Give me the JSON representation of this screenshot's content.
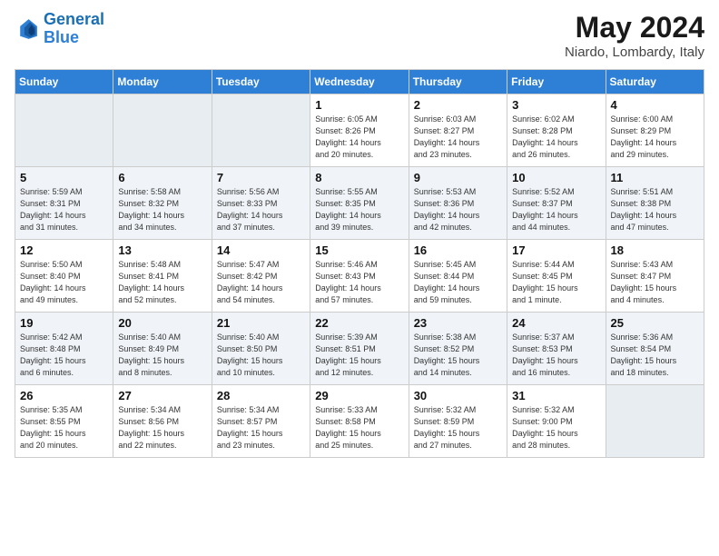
{
  "logo": {
    "line1": "General",
    "line2": "Blue"
  },
  "title": "May 2024",
  "subtitle": "Niardo, Lombardy, Italy",
  "days_header": [
    "Sunday",
    "Monday",
    "Tuesday",
    "Wednesday",
    "Thursday",
    "Friday",
    "Saturday"
  ],
  "weeks": [
    [
      {
        "day": "",
        "info": ""
      },
      {
        "day": "",
        "info": ""
      },
      {
        "day": "",
        "info": ""
      },
      {
        "day": "1",
        "info": "Sunrise: 6:05 AM\nSunset: 8:26 PM\nDaylight: 14 hours\nand 20 minutes."
      },
      {
        "day": "2",
        "info": "Sunrise: 6:03 AM\nSunset: 8:27 PM\nDaylight: 14 hours\nand 23 minutes."
      },
      {
        "day": "3",
        "info": "Sunrise: 6:02 AM\nSunset: 8:28 PM\nDaylight: 14 hours\nand 26 minutes."
      },
      {
        "day": "4",
        "info": "Sunrise: 6:00 AM\nSunset: 8:29 PM\nDaylight: 14 hours\nand 29 minutes."
      }
    ],
    [
      {
        "day": "5",
        "info": "Sunrise: 5:59 AM\nSunset: 8:31 PM\nDaylight: 14 hours\nand 31 minutes."
      },
      {
        "day": "6",
        "info": "Sunrise: 5:58 AM\nSunset: 8:32 PM\nDaylight: 14 hours\nand 34 minutes."
      },
      {
        "day": "7",
        "info": "Sunrise: 5:56 AM\nSunset: 8:33 PM\nDaylight: 14 hours\nand 37 minutes."
      },
      {
        "day": "8",
        "info": "Sunrise: 5:55 AM\nSunset: 8:35 PM\nDaylight: 14 hours\nand 39 minutes."
      },
      {
        "day": "9",
        "info": "Sunrise: 5:53 AM\nSunset: 8:36 PM\nDaylight: 14 hours\nand 42 minutes."
      },
      {
        "day": "10",
        "info": "Sunrise: 5:52 AM\nSunset: 8:37 PM\nDaylight: 14 hours\nand 44 minutes."
      },
      {
        "day": "11",
        "info": "Sunrise: 5:51 AM\nSunset: 8:38 PM\nDaylight: 14 hours\nand 47 minutes."
      }
    ],
    [
      {
        "day": "12",
        "info": "Sunrise: 5:50 AM\nSunset: 8:40 PM\nDaylight: 14 hours\nand 49 minutes."
      },
      {
        "day": "13",
        "info": "Sunrise: 5:48 AM\nSunset: 8:41 PM\nDaylight: 14 hours\nand 52 minutes."
      },
      {
        "day": "14",
        "info": "Sunrise: 5:47 AM\nSunset: 8:42 PM\nDaylight: 14 hours\nand 54 minutes."
      },
      {
        "day": "15",
        "info": "Sunrise: 5:46 AM\nSunset: 8:43 PM\nDaylight: 14 hours\nand 57 minutes."
      },
      {
        "day": "16",
        "info": "Sunrise: 5:45 AM\nSunset: 8:44 PM\nDaylight: 14 hours\nand 59 minutes."
      },
      {
        "day": "17",
        "info": "Sunrise: 5:44 AM\nSunset: 8:45 PM\nDaylight: 15 hours\nand 1 minute."
      },
      {
        "day": "18",
        "info": "Sunrise: 5:43 AM\nSunset: 8:47 PM\nDaylight: 15 hours\nand 4 minutes."
      }
    ],
    [
      {
        "day": "19",
        "info": "Sunrise: 5:42 AM\nSunset: 8:48 PM\nDaylight: 15 hours\nand 6 minutes."
      },
      {
        "day": "20",
        "info": "Sunrise: 5:40 AM\nSunset: 8:49 PM\nDaylight: 15 hours\nand 8 minutes."
      },
      {
        "day": "21",
        "info": "Sunrise: 5:40 AM\nSunset: 8:50 PM\nDaylight: 15 hours\nand 10 minutes."
      },
      {
        "day": "22",
        "info": "Sunrise: 5:39 AM\nSunset: 8:51 PM\nDaylight: 15 hours\nand 12 minutes."
      },
      {
        "day": "23",
        "info": "Sunrise: 5:38 AM\nSunset: 8:52 PM\nDaylight: 15 hours\nand 14 minutes."
      },
      {
        "day": "24",
        "info": "Sunrise: 5:37 AM\nSunset: 8:53 PM\nDaylight: 15 hours\nand 16 minutes."
      },
      {
        "day": "25",
        "info": "Sunrise: 5:36 AM\nSunset: 8:54 PM\nDaylight: 15 hours\nand 18 minutes."
      }
    ],
    [
      {
        "day": "26",
        "info": "Sunrise: 5:35 AM\nSunset: 8:55 PM\nDaylight: 15 hours\nand 20 minutes."
      },
      {
        "day": "27",
        "info": "Sunrise: 5:34 AM\nSunset: 8:56 PM\nDaylight: 15 hours\nand 22 minutes."
      },
      {
        "day": "28",
        "info": "Sunrise: 5:34 AM\nSunset: 8:57 PM\nDaylight: 15 hours\nand 23 minutes."
      },
      {
        "day": "29",
        "info": "Sunrise: 5:33 AM\nSunset: 8:58 PM\nDaylight: 15 hours\nand 25 minutes."
      },
      {
        "day": "30",
        "info": "Sunrise: 5:32 AM\nSunset: 8:59 PM\nDaylight: 15 hours\nand 27 minutes."
      },
      {
        "day": "31",
        "info": "Sunrise: 5:32 AM\nSunset: 9:00 PM\nDaylight: 15 hours\nand 28 minutes."
      },
      {
        "day": "",
        "info": ""
      }
    ]
  ]
}
